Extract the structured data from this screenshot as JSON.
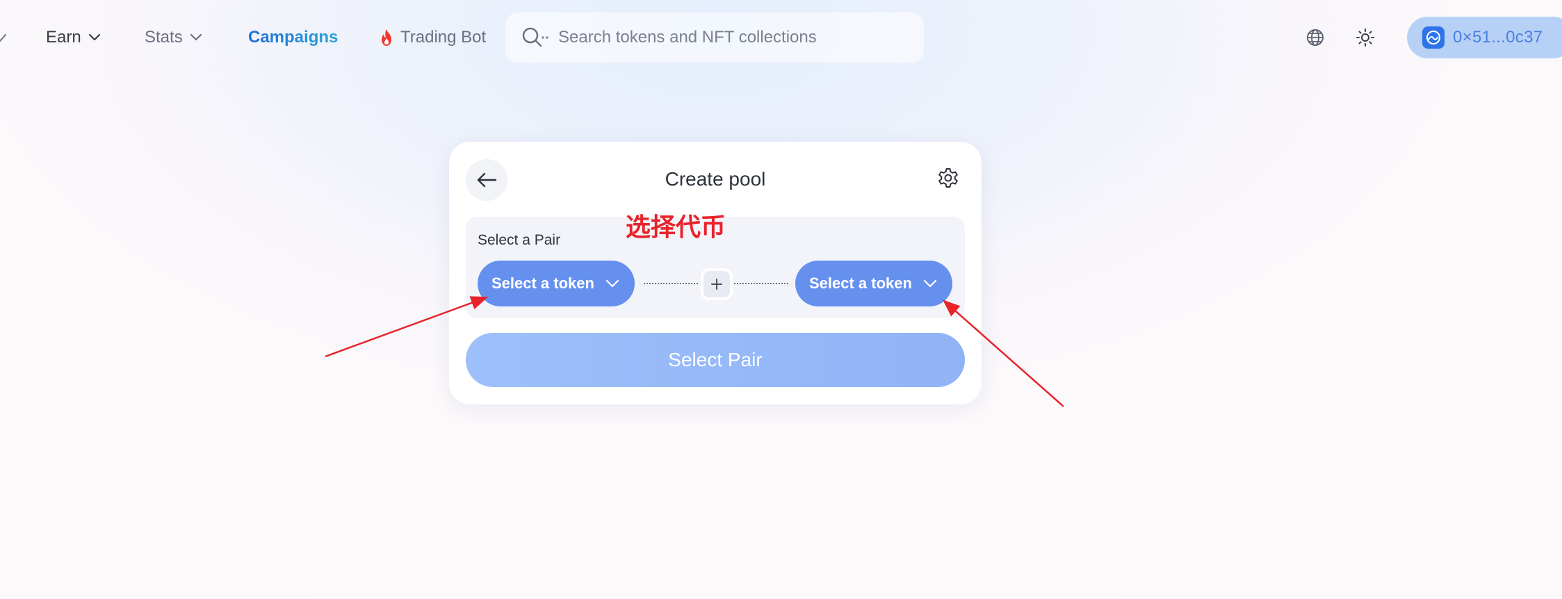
{
  "nav": {
    "earn": "Earn",
    "stats": "Stats",
    "campaigns": "Campaigns",
    "trading_bot": "Trading Bot"
  },
  "search": {
    "placeholder": "Search tokens and NFT collections"
  },
  "wallet": {
    "address": "0×51...0c37"
  },
  "card": {
    "title": "Create pool",
    "pair_label": "Select a Pair",
    "token_a": "Select a token",
    "token_b": "Select a token",
    "submit": "Select Pair"
  },
  "annotation": {
    "text": "选择代币",
    "color": "#e8232a"
  },
  "colors": {
    "accent": "#6690ee",
    "submit_disabled": "#9dc0fa",
    "campaigns_gradient": [
      "#1f6fd6",
      "#2aa3d8"
    ],
    "wallet_bg": "#b7d0f6"
  },
  "icons": [
    "chevron-down-icon",
    "fire-icon",
    "search-icon",
    "globe-icon",
    "sun-icon",
    "wallet-avatar-icon",
    "arrow-left-icon",
    "gear-icon",
    "plus-icon"
  ]
}
